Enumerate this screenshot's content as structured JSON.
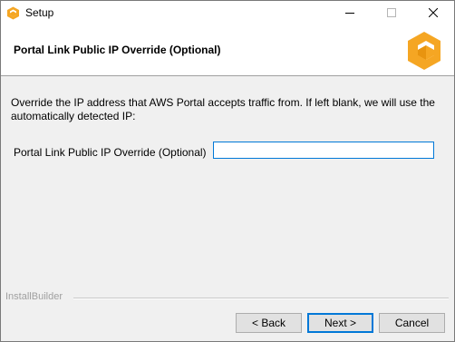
{
  "window": {
    "title": "Setup",
    "controls": {
      "minimize": "—",
      "maximize": "☐",
      "close": "✕"
    }
  },
  "header": {
    "title": "Portal Link Public IP Override (Optional)",
    "logo_icon": "cube-logo-icon",
    "accent_color": "#f5a623"
  },
  "body": {
    "description": "Override the IP address that AWS Portal accepts traffic from. If left blank, we will use the automatically detected IP:",
    "field_label": "Portal Link Public IP Override (Optional)",
    "field_value": ""
  },
  "footer": {
    "brand": "InstallBuilder",
    "back_label": "< Back",
    "next_label": "Next >",
    "cancel_label": "Cancel"
  }
}
